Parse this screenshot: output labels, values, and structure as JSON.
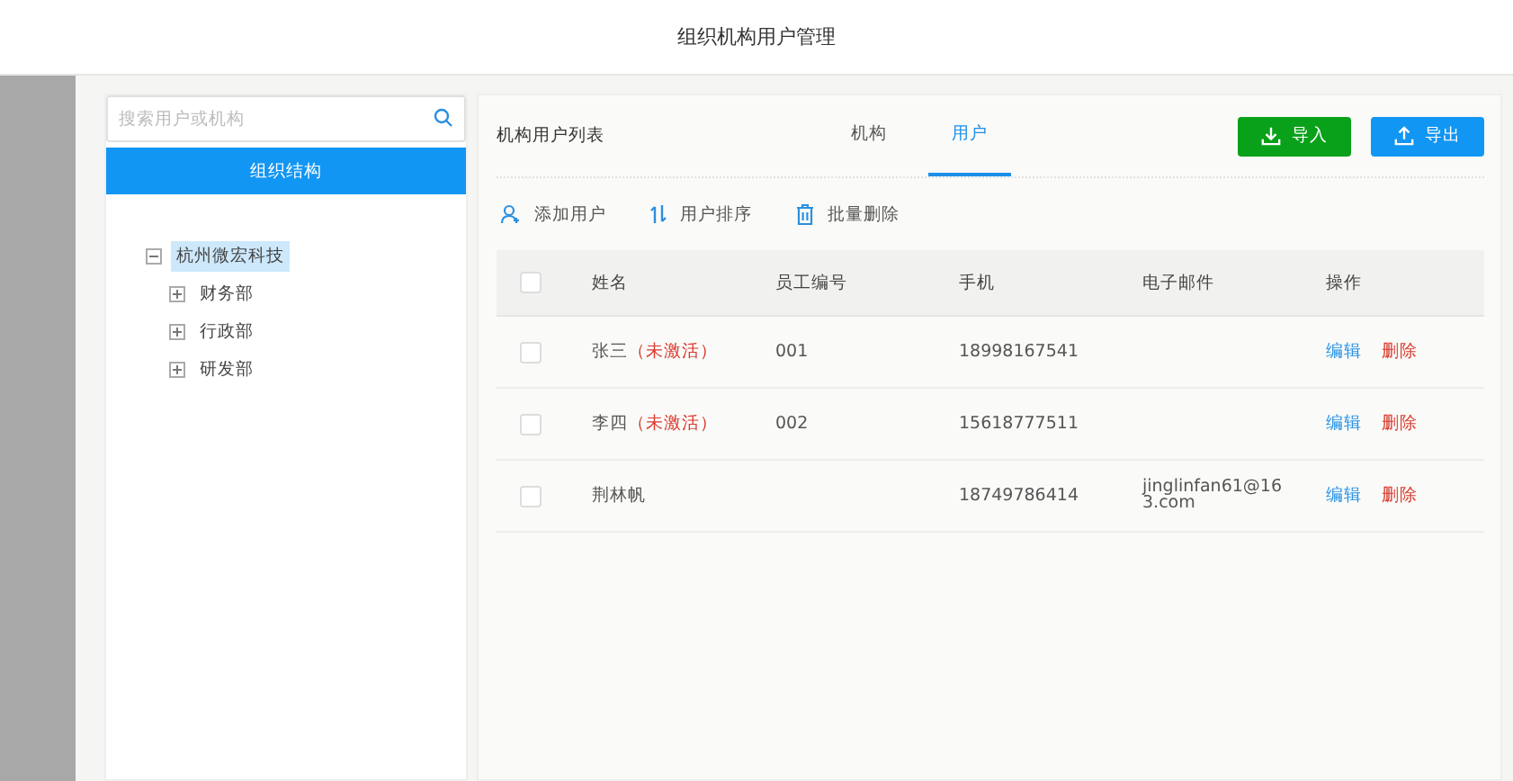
{
  "window": {
    "title": "组织机构用户管理"
  },
  "sidebar": {
    "search": {
      "placeholder": "搜索用户或机构"
    },
    "heading": "组织结构",
    "tree": [
      {
        "label": "杭州微宏科技",
        "expanded": true,
        "selected": true,
        "children": [
          {
            "label": "财务部",
            "expanded": false,
            "selected": false
          },
          {
            "label": "行政部",
            "expanded": false,
            "selected": false
          },
          {
            "label": "研发部",
            "expanded": false,
            "selected": false
          }
        ]
      }
    ]
  },
  "panel": {
    "title": "机构用户列表",
    "tabs": [
      {
        "label": "机构",
        "selected": false
      },
      {
        "label": "用户",
        "selected": true
      }
    ],
    "buttons": [
      {
        "label": "导入",
        "kind": "import"
      },
      {
        "label": "导出",
        "kind": "export"
      }
    ],
    "toolbar": [
      {
        "label": "添加用户",
        "kind": "add"
      },
      {
        "label": "用户排序",
        "kind": "sort"
      },
      {
        "label": "批量删除",
        "kind": "delete"
      }
    ],
    "table": {
      "columns": [
        "姓名",
        "员工编号",
        "手机",
        "电子邮件",
        "操作"
      ],
      "header_checked": false,
      "rows": [
        {
          "checked": false,
          "name": "张三",
          "status": "（未激活）",
          "id": "001",
          "phone": "18998167541",
          "actions": [
            "编辑",
            "删除"
          ]
        },
        {
          "checked": false,
          "name": "李四",
          "status": "（未激活）",
          "id": "002",
          "phone": "15618777511",
          "actions": [
            "编辑",
            "删除"
          ]
        },
        {
          "checked": false,
          "name": "荆林帆",
          "phone": "18749786414",
          "email": "jinglinfan61@163.com",
          "actions": [
            "编辑",
            "删除"
          ]
        }
      ]
    }
  }
}
